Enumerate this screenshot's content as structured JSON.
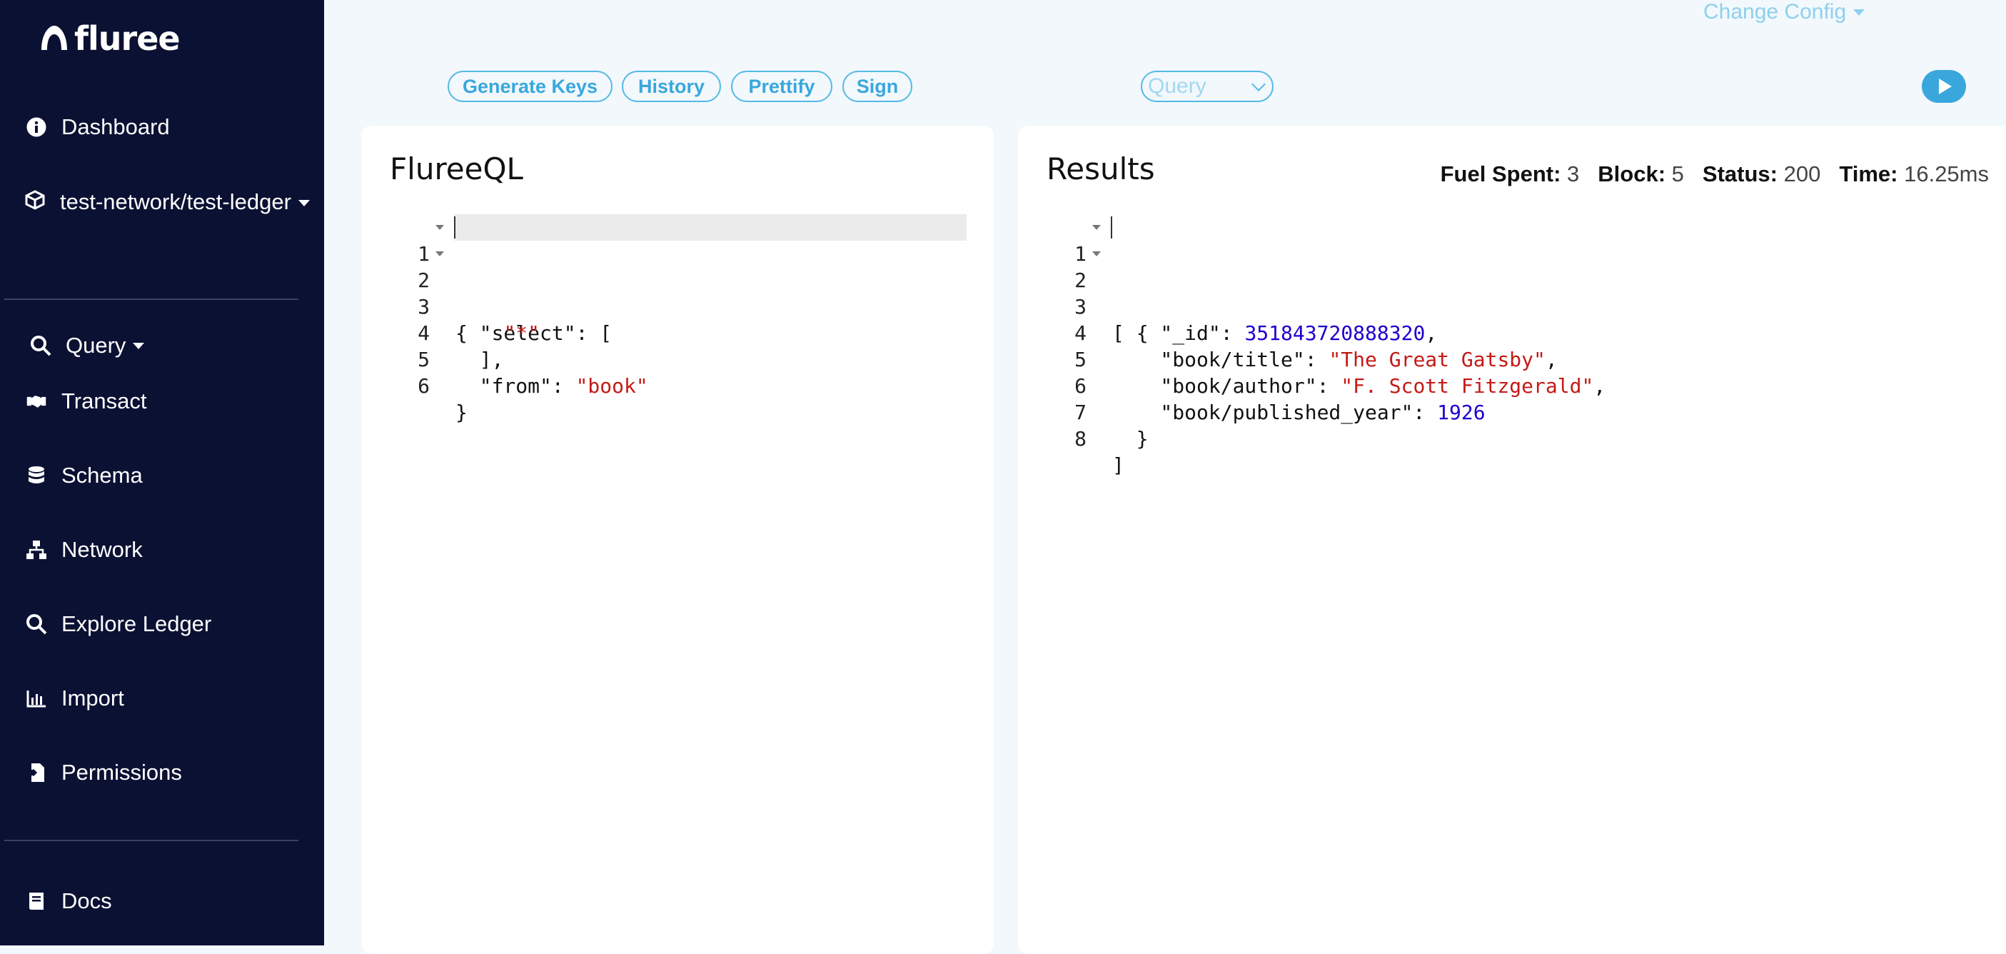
{
  "app": {
    "logo_text": "fluree"
  },
  "sidebar": {
    "dashboard": "Dashboard",
    "ledger": "test-network/test-ledger",
    "query": "Query",
    "transact": "Transact",
    "schema": "Schema",
    "network": "Network",
    "explore": "Explore Ledger",
    "import": "Import",
    "permissions": "Permissions",
    "docs": "Docs"
  },
  "topbar": {
    "change_config": "Change Config",
    "generate_keys": "Generate Keys",
    "history": "History",
    "prettify": "Prettify",
    "sign": "Sign",
    "query_type": "Query"
  },
  "editor": {
    "title": "FlureeQL",
    "lines": [
      [
        "1",
        "{"
      ],
      [
        "2",
        "  \"select\": ["
      ],
      [
        "3",
        "    \"*\""
      ],
      [
        "4",
        "  ],"
      ],
      [
        "5",
        "  \"from\": \"book\""
      ],
      [
        "6",
        "}"
      ]
    ]
  },
  "results": {
    "title": "Results",
    "fuel_label": "Fuel Spent:",
    "fuel": "3",
    "block_label": "Block:",
    "block": "5",
    "status_label": "Status:",
    "status": "200",
    "time_label": "Time:",
    "time": "16.25ms",
    "id": "351843720888320",
    "title_val": "\"The Great Gatsby\"",
    "author_val": "\"F. Scott Fitzgerald\"",
    "year_val": "1926"
  },
  "colors": {
    "sidebar_bg": "#0b1133",
    "accent": "#3aa7dc",
    "page_bg": "#f2f8fc"
  }
}
